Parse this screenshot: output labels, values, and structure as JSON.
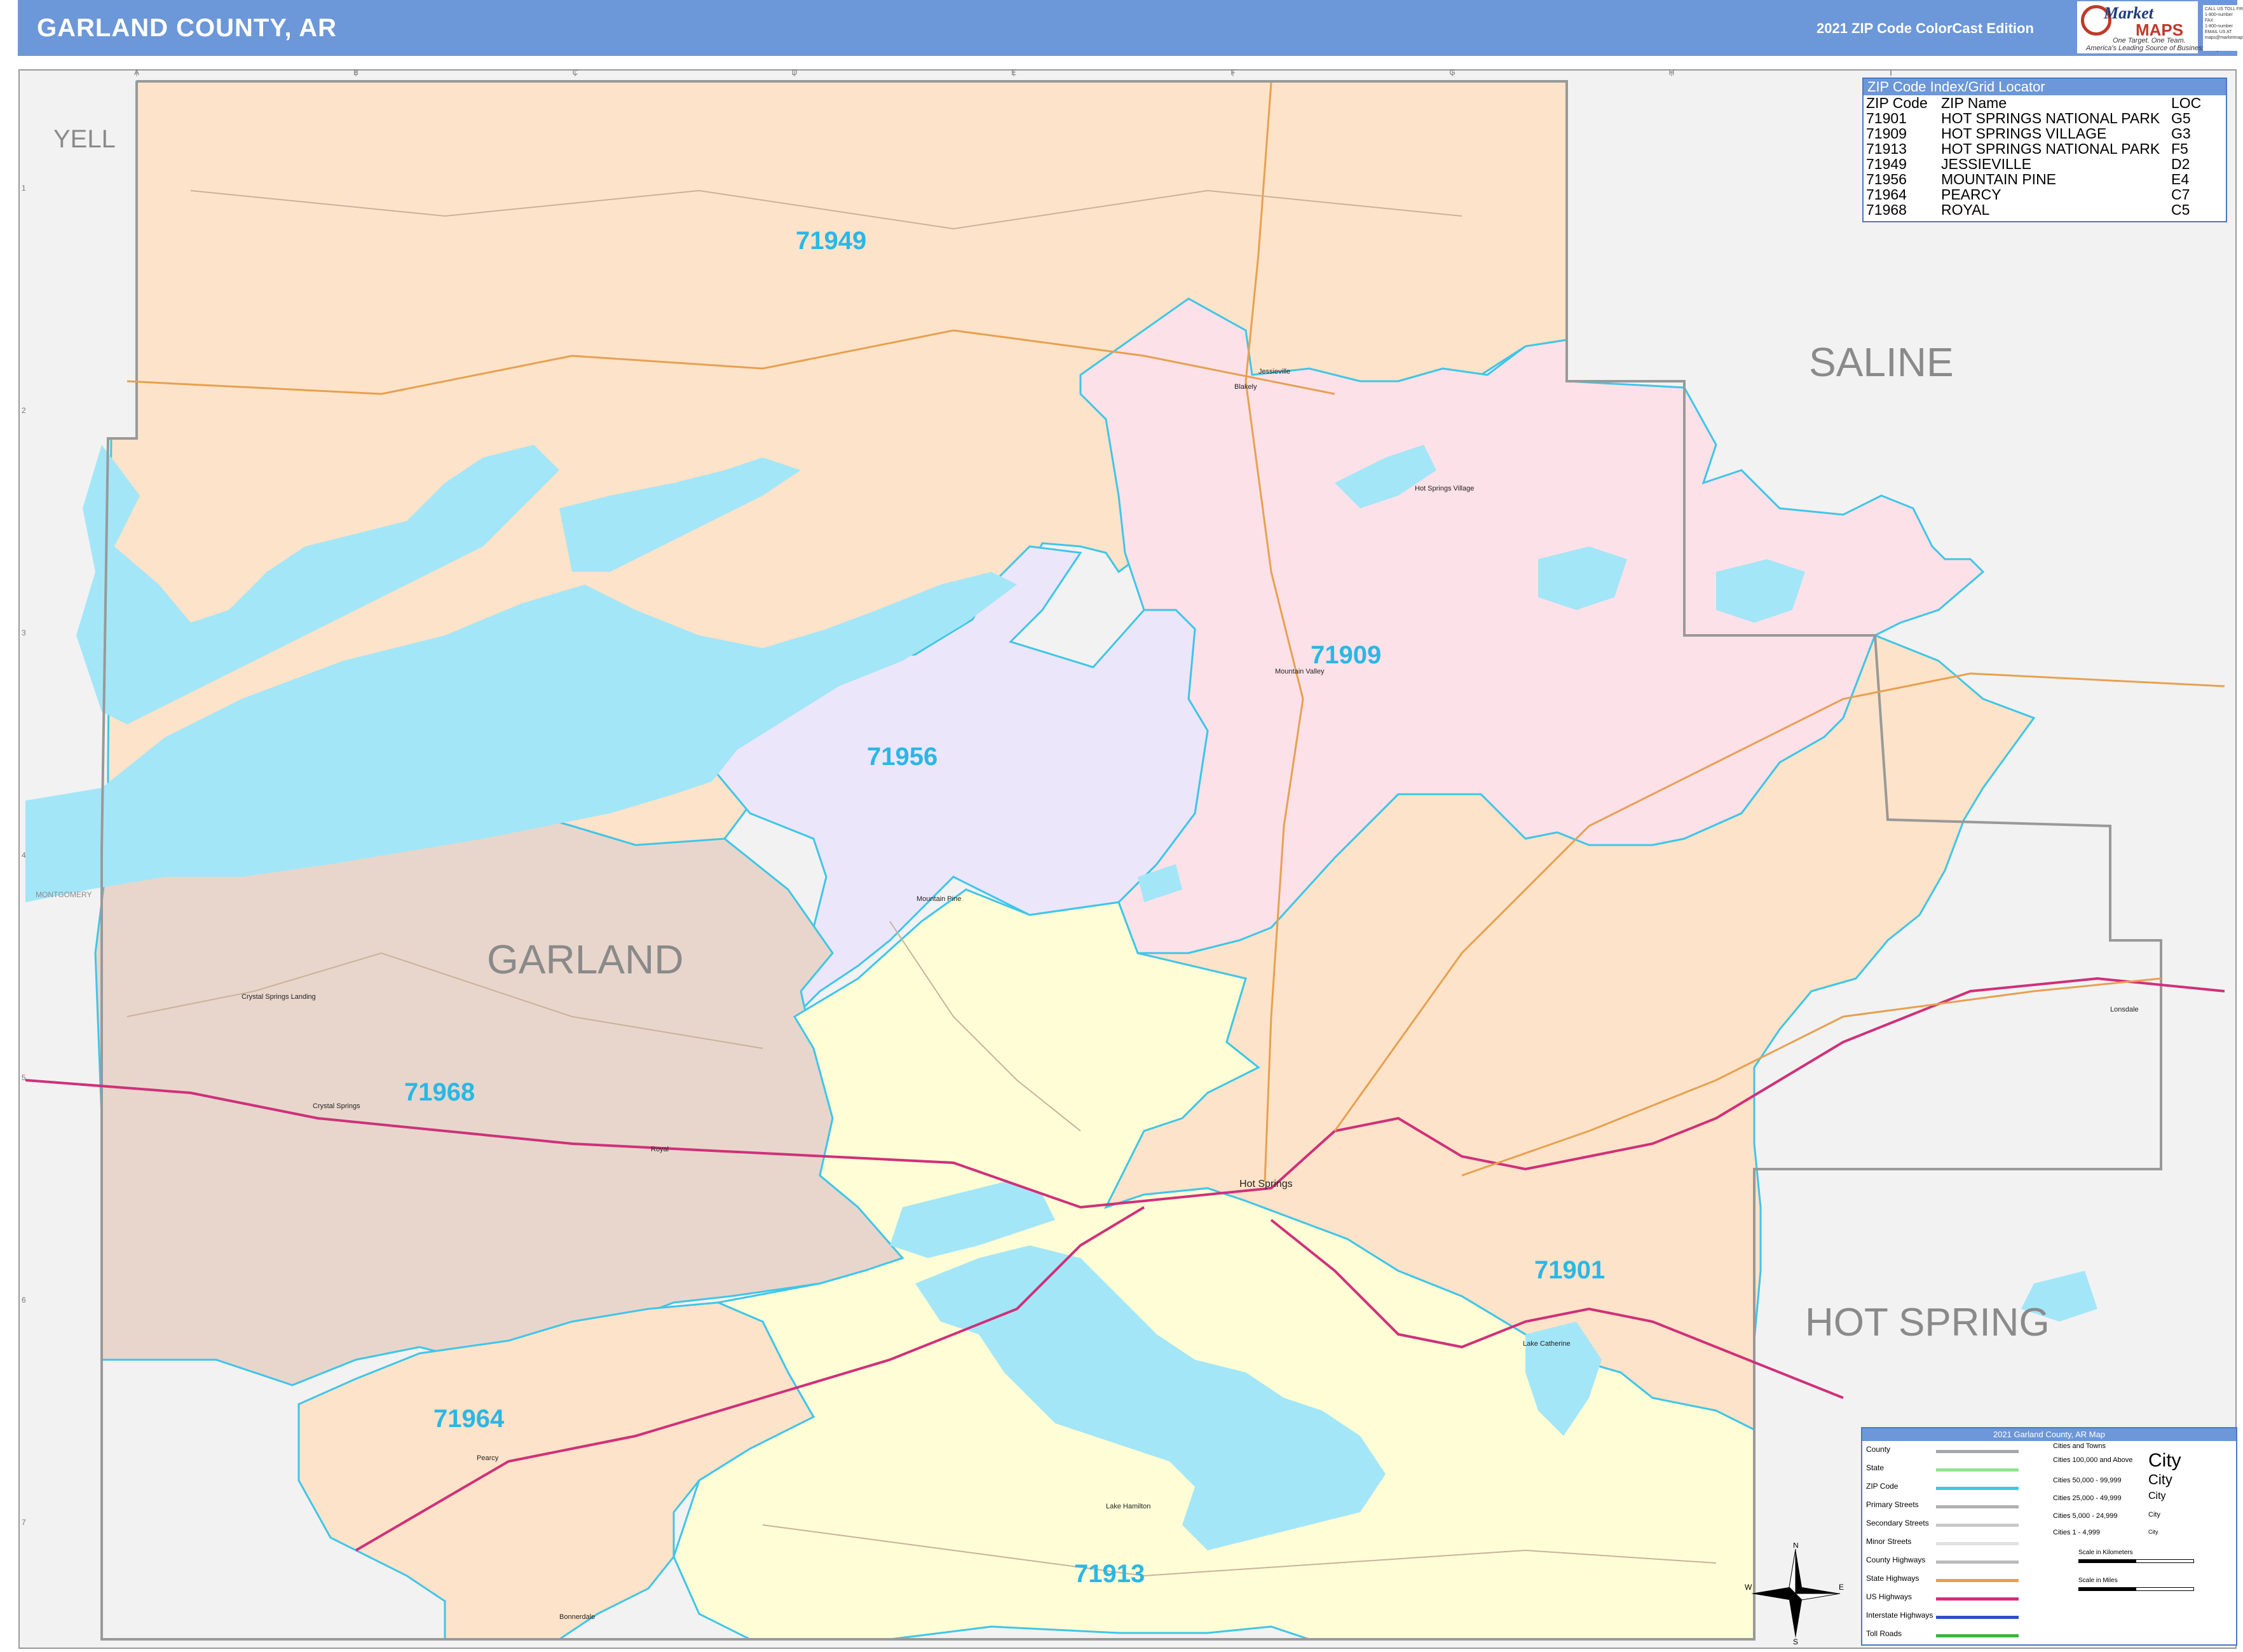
{
  "header": {
    "title": "GARLAND COUNTY, AR",
    "edition": "2021 ZIP Code ColorCast Edition"
  },
  "logo": {
    "word_top": "Market",
    "word_bottom": "MAPS",
    "tagline1": "One Target. One Team.",
    "tagline2": "America's Leading Source of Business Maps"
  },
  "contact": [
    "CALL US TOLL FREE",
    "1-800-number",
    "FAX",
    "1-800-number",
    "EMAIL US AT",
    "maps@marketmaps.com"
  ],
  "grid": {
    "columns": [
      "A",
      "B",
      "C",
      "D",
      "E",
      "F",
      "G",
      "H",
      "I"
    ],
    "rows": [
      "1",
      "2",
      "3",
      "4",
      "5",
      "6",
      "7"
    ]
  },
  "map_labels": {
    "county_name": "GARLAND",
    "neighbors": [
      "YELL",
      "SALINE",
      "HOT SPRING"
    ],
    "neighbor_small": "MONTGOMERY",
    "zip_labels": [
      "71949",
      "71909",
      "71956",
      "71968",
      "71901",
      "71964",
      "71913"
    ],
    "places": [
      {
        "name": "Jessieville"
      },
      {
        "name": "Blakely"
      },
      {
        "name": "Hot Springs Village"
      },
      {
        "name": "Mountain Valley"
      },
      {
        "name": "Mountain Pine"
      },
      {
        "name": "Crystal Springs Landing"
      },
      {
        "name": "Crystal Springs"
      },
      {
        "name": "Royal"
      },
      {
        "name": "Hot Springs"
      },
      {
        "name": "Lake Catherine"
      },
      {
        "name": "Lake Hamilton"
      },
      {
        "name": "Lonsdale"
      },
      {
        "name": "Pearcy"
      },
      {
        "name": "Bonnerdale"
      }
    ]
  },
  "zip_index": {
    "title": "ZIP Code Index/Grid Locator",
    "columns": [
      "ZIP Code",
      "ZIP Name",
      "LOC"
    ],
    "rows": [
      [
        "71901",
        "HOT SPRINGS NATIONAL PARK",
        "G5"
      ],
      [
        "71909",
        "HOT SPRINGS VILLAGE",
        "G3"
      ],
      [
        "71913",
        "HOT SPRINGS NATIONAL PARK",
        "F5"
      ],
      [
        "71949",
        "JESSIEVILLE",
        "D2"
      ],
      [
        "71956",
        "MOUNTAIN PINE",
        "E4"
      ],
      [
        "71964",
        "PEARCY",
        "C7"
      ],
      [
        "71968",
        "ROYAL",
        "C5"
      ]
    ]
  },
  "legend": {
    "title": "2021 Garland County, AR Map",
    "items": [
      {
        "label": "County",
        "color": "#a6a6a6"
      },
      {
        "label": "State",
        "color": "#8ee68e"
      },
      {
        "label": "ZIP Code",
        "color": "#3fc6e8"
      },
      {
        "label": "Primary Streets",
        "color": "#b0b0b0"
      },
      {
        "label": "Secondary Streets",
        "color": "#c8c8c8"
      },
      {
        "label": "Minor Streets",
        "color": "#e0e0e0"
      },
      {
        "label": "County Highways",
        "color": "#bbbbbb"
      },
      {
        "label": "State Highways",
        "color": "#e8a050"
      },
      {
        "label": "US Highways",
        "color": "#d0307a"
      },
      {
        "label": "Interstate Highways",
        "color": "#3050c0"
      },
      {
        "label": "Toll Roads",
        "color": "#40b040"
      }
    ],
    "cities_title": "Cities and Towns",
    "cities": [
      {
        "label": "Cities 100,000 and Above",
        "sample": "City"
      },
      {
        "label": "Cities 50,000 - 99,999",
        "sample": "City"
      },
      {
        "label": "Cities 25,000 - 49,999",
        "sample": "City"
      },
      {
        "label": "Cities 5,000 - 24,999",
        "sample": "City"
      },
      {
        "label": "Cities 1 - 4,999",
        "sample": "City"
      }
    ],
    "scale_km": "Scale in Kilometers",
    "scale_mi": "Scale in Miles"
  },
  "compass": {
    "n": "N",
    "s": "S",
    "e": "E",
    "w": "W"
  },
  "colors": {
    "header_blue": "#6c97d8",
    "zip_71949": "#fde3c9",
    "zip_71901": "#fde3c9",
    "zip_71964": "#fde3c9",
    "zip_71909": "#fde1e8",
    "zip_71956": "#ece6fb",
    "zip_71968": "#e8d6cc",
    "zip_71913": "#fefdd6",
    "water": "#a3e6f8",
    "zip_border": "#3fc6e8",
    "outside": "#f2f2f2"
  }
}
